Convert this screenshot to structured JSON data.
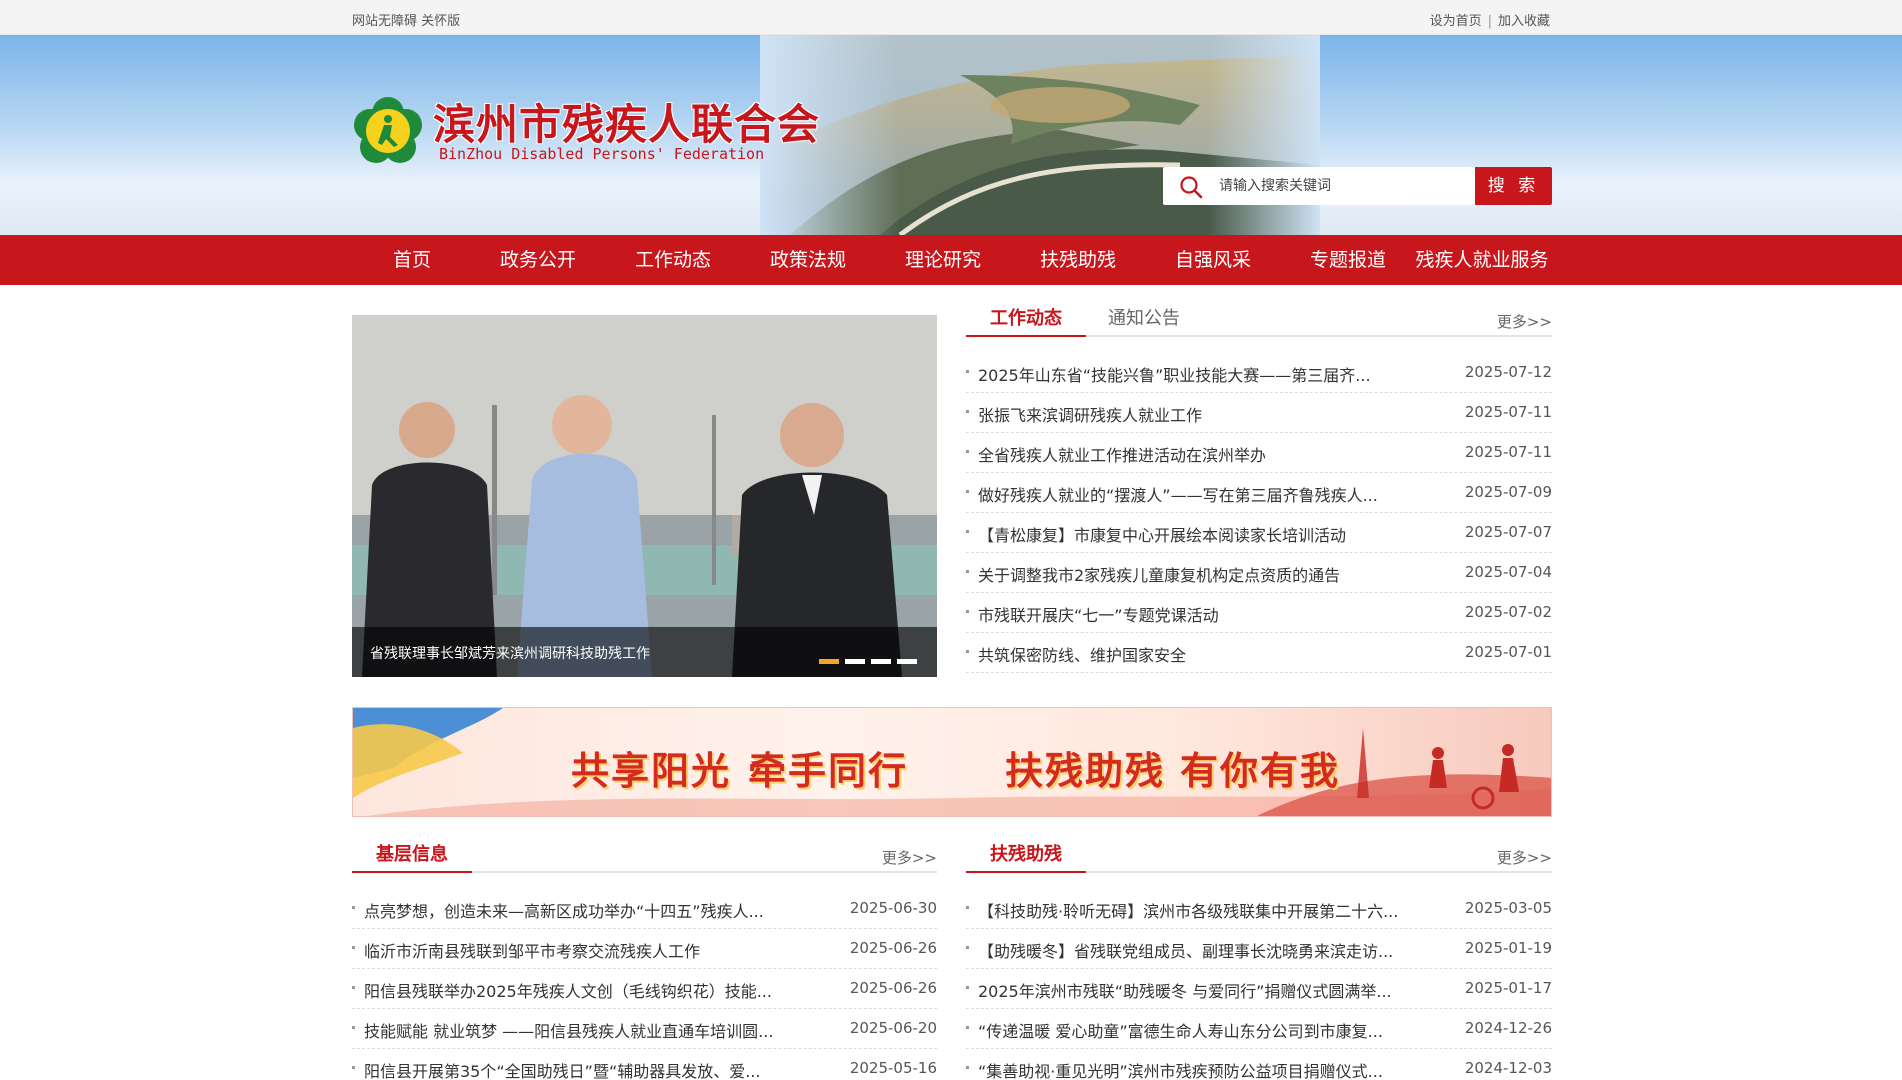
{
  "topbar": {
    "left_text": "网站无障碍 关怀版",
    "set_home": "设为首页",
    "sep": "|",
    "favorite": "加入收藏"
  },
  "header": {
    "title": "滨州市残疾人联合会",
    "subtitle": "BinZhou Disabled Persons' Federation",
    "search_placeholder": "请输入搜索关键词",
    "search_button": "搜 索",
    "brand_color": "#c8161d"
  },
  "nav": [
    {
      "label": "首页"
    },
    {
      "label": "政务公开"
    },
    {
      "label": "工作动态"
    },
    {
      "label": "政策法规"
    },
    {
      "label": "理论研究"
    },
    {
      "label": "扶残助残"
    },
    {
      "label": "自强风采"
    },
    {
      "label": "专题报道"
    },
    {
      "label": "残疾人就业服务"
    }
  ],
  "slider": {
    "caption": "省残联理事长邹斌芳来滨州调研科技助残工作",
    "current": 1,
    "count": 4
  },
  "news": {
    "tab_active": "工作动态",
    "tab_other": "通知公告",
    "more": "更多>>",
    "items": [
      {
        "title": "2025年山东省“技能兴鲁”职业技能大赛——第三届齐...",
        "date": "2025-07-12"
      },
      {
        "title": "张振飞来滨调研残疾人就业工作",
        "date": "2025-07-11"
      },
      {
        "title": "全省残疾人就业工作推进活动在滨州举办",
        "date": "2025-07-11"
      },
      {
        "title": "做好残疾人就业的“摆渡人”——写在第三届齐鲁残疾人...",
        "date": "2025-07-09"
      },
      {
        "title": "【青松康复】市康复中心开展绘本阅读家长培训活动",
        "date": "2025-07-07"
      },
      {
        "title": "关于调整我市2家残疾儿童康复机构定点资质的通告",
        "date": "2025-07-04"
      },
      {
        "title": "市残联开展庆“七一”专题党课活动",
        "date": "2025-07-02"
      },
      {
        "title": "共筑保密防线、维护国家安全",
        "date": "2025-07-01"
      }
    ]
  },
  "banner_ad": {
    "slogans": [
      "共享阳光",
      "牵手同行",
      "扶残助残",
      "有你有我"
    ]
  },
  "grassroots": {
    "title": "基层信息",
    "more": "更多>>",
    "items": [
      {
        "title": "点亮梦想，创造未来—高新区成功举办“十四五”残疾人...",
        "date": "2025-06-30"
      },
      {
        "title": "临沂市沂南县残联到邹平市考察交流残疾人工作",
        "date": "2025-06-26"
      },
      {
        "title": "阳信县残联举办2025年残疾人文创（毛线钩织花）技能...",
        "date": "2025-06-26"
      },
      {
        "title": "技能赋能 就业筑梦 ——阳信县残疾人就业直通车培训圆...",
        "date": "2025-06-20"
      },
      {
        "title": "阳信县开展第35个“全国助残日”暨“辅助器具发放、爱...",
        "date": "2025-05-16"
      }
    ]
  },
  "help": {
    "title": "扶残助残",
    "more": "更多>>",
    "items": [
      {
        "title": "【科技助残·聆听无碍】滨州市各级残联集中开展第二十六...",
        "date": "2025-03-05"
      },
      {
        "title": "【助残暖冬】省残联党组成员、副理事长沈晓勇来滨走访...",
        "date": "2025-01-19"
      },
      {
        "title": "2025年滨州市残联“助残暖冬 与爱同行”捐赠仪式圆满举...",
        "date": "2025-01-17"
      },
      {
        "title": "“传递温暖 爱心助童”富德生命人寿山东分公司到市康复...",
        "date": "2024-12-26"
      },
      {
        "title": "“集善助视·重见光明”滨州市残疾预防公益项目捐赠仪式...",
        "date": "2024-12-03"
      }
    ]
  }
}
